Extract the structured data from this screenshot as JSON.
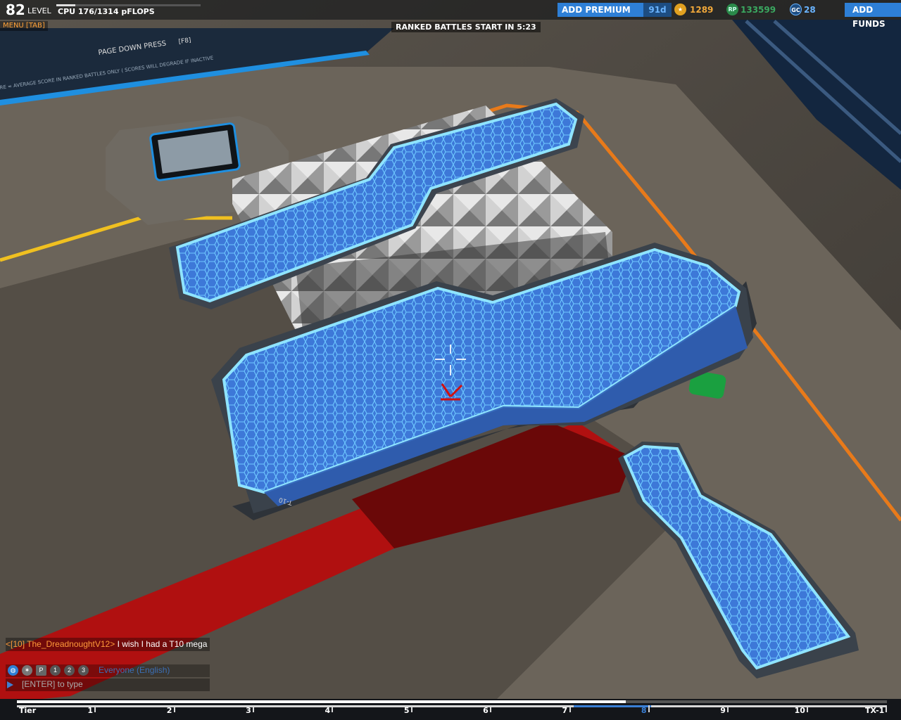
{
  "hud": {
    "level": {
      "number": "82",
      "label": "LEVEL"
    },
    "cpu": {
      "text": "CPU 176/1314 pFLOPS",
      "used": 176,
      "max": 1314
    },
    "menu_label": "MENU [TAB]",
    "countdown": "RANKED BATTLES START IN 5:23",
    "premium": {
      "button_label": "ADD PREMIUM",
      "days": "91d"
    },
    "currencies": {
      "robits": "1289",
      "rp": "133599",
      "gc": "28",
      "robits_icon": "star-icon",
      "rp_icon": "rp-coin-icon",
      "gc_icon": "gc-coin-icon",
      "rp_icon_text": "RP",
      "gc_icon_text": "GC"
    },
    "funds_button_label": "ADD FUNDS"
  },
  "background_screen": {
    "line1": "PAGE DOWN PRESS",
    "key": "[F8]",
    "line2": "RE = AVERAGE SCORE IN RANKED BATTLES ONLY ( SCORES WILL DEGRADE IF INACTIVE"
  },
  "chat": {
    "sender": "<[10] The_DreadnoughtV12>",
    "message": "I wish I had a T10 mega",
    "channel_label": "Everyone (English)",
    "input_placeholder": "[ENTER] to type",
    "channel_icons": [
      "globe-icon",
      "clan-icon",
      "party-icon",
      "squad-1-icon",
      "squad-2-icon",
      "squad-3-icon"
    ],
    "channel_icon_text": [
      "P",
      "1",
      "2",
      "3"
    ]
  },
  "tier_bar": {
    "labels": [
      "Tier",
      "1",
      "2",
      "3",
      "4",
      "5",
      "6",
      "7",
      "8",
      "9",
      "10",
      "TX-1"
    ],
    "current_tier": "8",
    "progress": 0.7
  },
  "world": {
    "piece_label": "T-10",
    "colors": {
      "accent": "#2e7fd6",
      "orange": "#e87a1a",
      "yellow": "#f0c020",
      "red": "#c81010",
      "green": "#1aa040"
    }
  }
}
